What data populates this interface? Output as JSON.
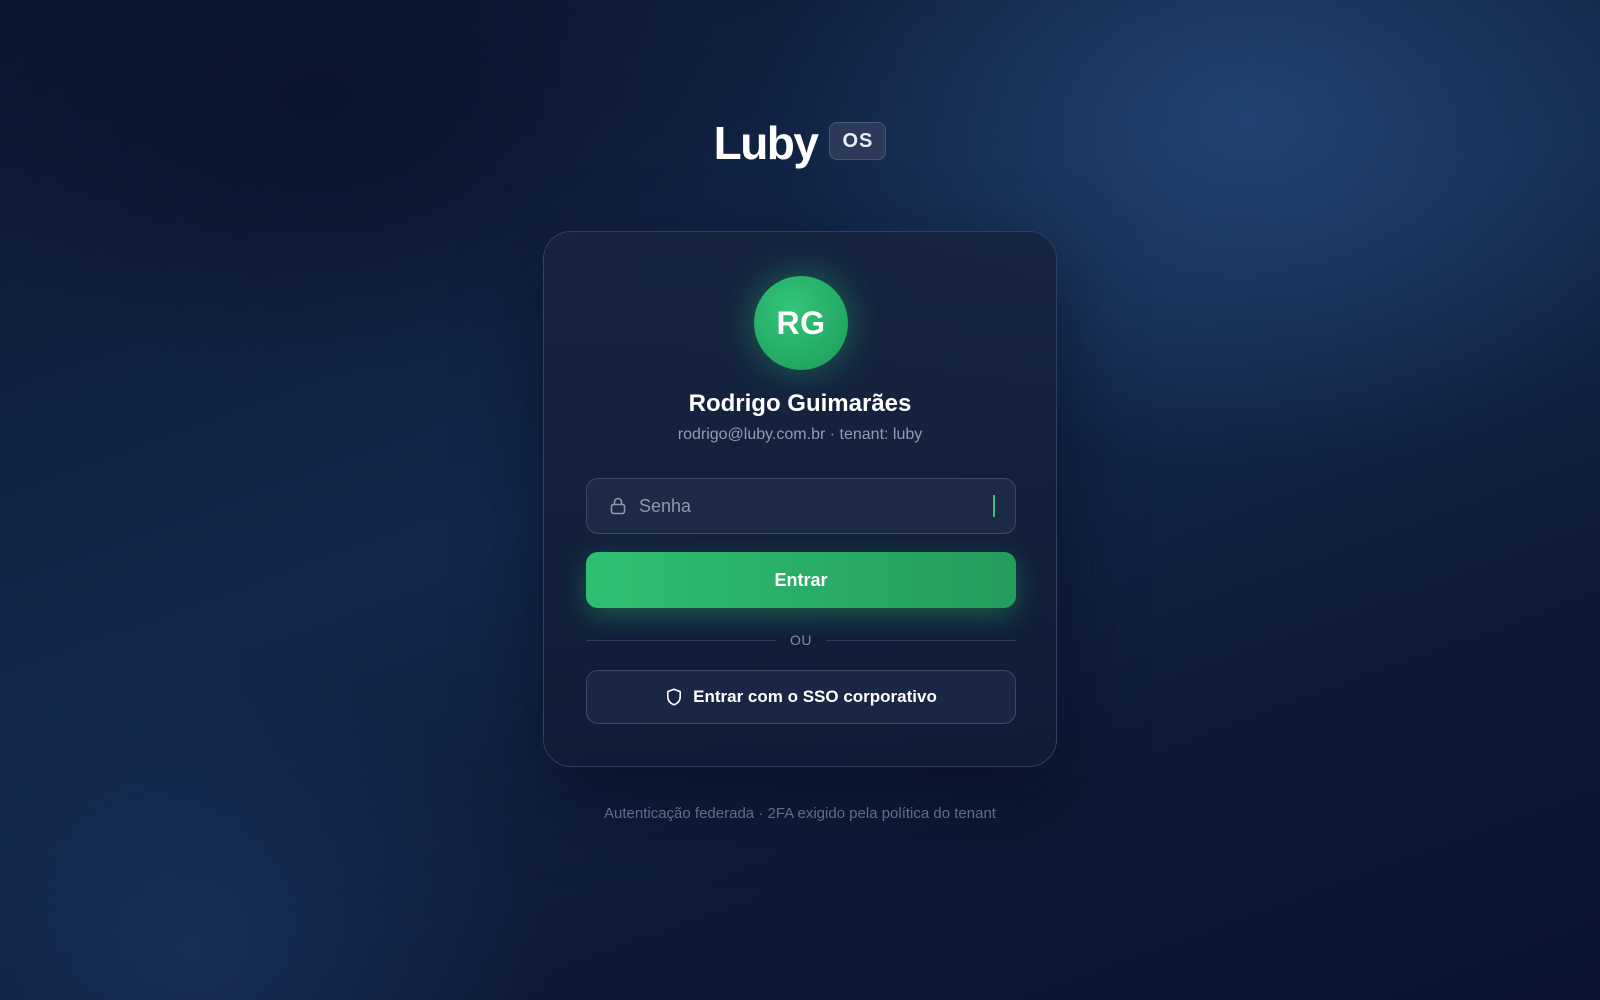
{
  "brand": {
    "name": "Luby",
    "badge": "OS"
  },
  "user": {
    "initials": "RG",
    "name": "Rodrigo Guimarães",
    "subtitle": "rodrigo@luby.com.br · tenant: luby"
  },
  "login": {
    "password_placeholder": "Senha",
    "password_value": "",
    "submit_label": "Entrar",
    "divider_label": "OU",
    "sso_label": "Entrar com o SSO corporativo"
  },
  "footer": {
    "note": "Autenticação federada · 2FA exigido pela política do tenant"
  },
  "colors": {
    "accent": "#2fbf73",
    "background": "#0f1d3a",
    "card": "#162440"
  },
  "icons": {
    "password": "lock-icon",
    "sso": "shield-icon"
  }
}
